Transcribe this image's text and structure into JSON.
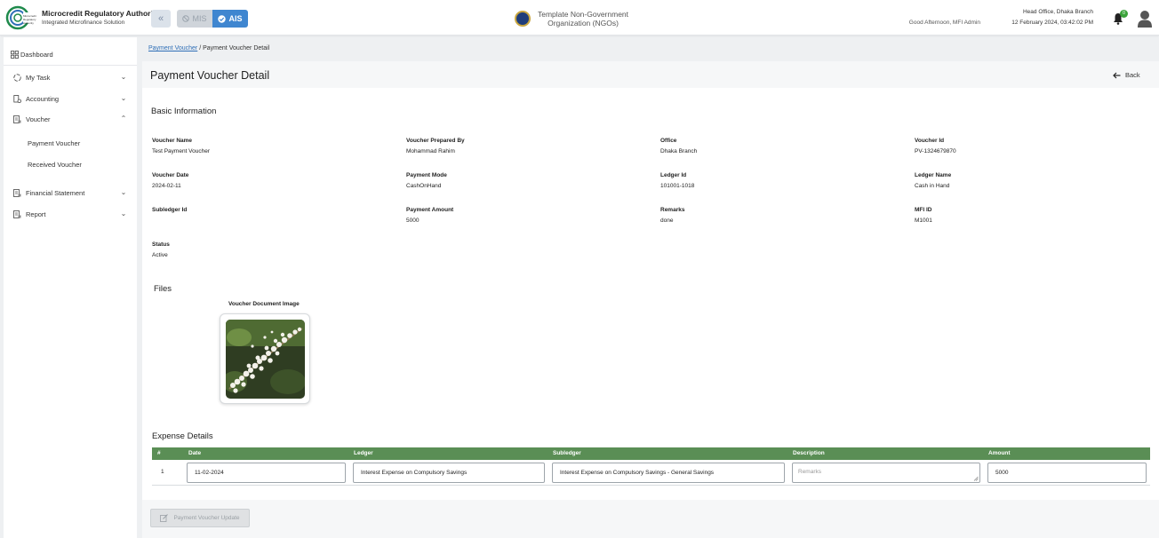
{
  "header": {
    "org_name": "Microcredit Regulatory Authority",
    "org_subtitle": "Integrated Microfinance Solution",
    "logo_text": "Microcredit Regulatory Authority",
    "mode_mis": "MIS",
    "mode_ais": "AIS",
    "ngo_name": "Template Non-Government Organization (NGOs)",
    "greeting": "Good Afternoon, MFI Admin",
    "branch": "Head Office, Dhaka Branch",
    "datetime": "12 February 2024, 03:42:02 PM",
    "notification_count": "0"
  },
  "sidebar": {
    "dashboard": "Dashboard",
    "items": [
      {
        "label": "My Task",
        "icon": "task-icon"
      },
      {
        "label": "Accounting",
        "icon": "accounting-icon"
      },
      {
        "label": "Voucher",
        "icon": "voucher-icon"
      },
      {
        "label": "Financial Statement",
        "icon": "statement-icon"
      },
      {
        "label": "Report",
        "icon": "report-icon"
      }
    ],
    "voucher_sub": [
      "Payment Voucher",
      "Received Voucher"
    ]
  },
  "breadcrumb": {
    "link": "Payment Voucher",
    "separator": "/",
    "current": "Payment Voucher Detail"
  },
  "page": {
    "title": "Payment Voucher Detail",
    "back": "Back"
  },
  "basic_info": {
    "title": "Basic Information",
    "fields": [
      {
        "label": "Voucher Name",
        "value": "Test Payment Voucher"
      },
      {
        "label": "Voucher Prepared By",
        "value": "Mohammad Rahim"
      },
      {
        "label": "Office",
        "value": "Dhaka Branch"
      },
      {
        "label": "Voucher Id",
        "value": "PV-1324679870"
      },
      {
        "label": "Voucher Date",
        "value": "2024-02-11"
      },
      {
        "label": "Payment Mode",
        "value": "CashOnHand"
      },
      {
        "label": "Ledger Id",
        "value": "101001-1018"
      },
      {
        "label": "Ledger Name",
        "value": "Cash in Hand"
      },
      {
        "label": "Subledger Id",
        "value": ""
      },
      {
        "label": "Payment Amount",
        "value": "5000"
      },
      {
        "label": "Remarks",
        "value": "done"
      },
      {
        "label": "MFI ID",
        "value": "M1001"
      },
      {
        "label": "Status",
        "value": "Active"
      }
    ]
  },
  "files": {
    "title": "Files",
    "doc_label": "Voucher Document Image"
  },
  "expense": {
    "title": "Expense Details",
    "columns": [
      "#",
      "Date",
      "Ledger",
      "Subledger",
      "Description",
      "Amount"
    ],
    "rows": [
      {
        "num": "1",
        "date": "11-02-2024",
        "ledger": "Interest Expense on Compulsory Savings",
        "subledger": "Interest Expense on Compulsory Savings - General Savings",
        "description_placeholder": "Remarks",
        "amount": "5000"
      }
    ]
  },
  "actions": {
    "update": "Payment Voucher Update"
  },
  "colors": {
    "accent": "#3f86d0",
    "table_header": "#5a8e55",
    "badge": "#3ca33b"
  }
}
